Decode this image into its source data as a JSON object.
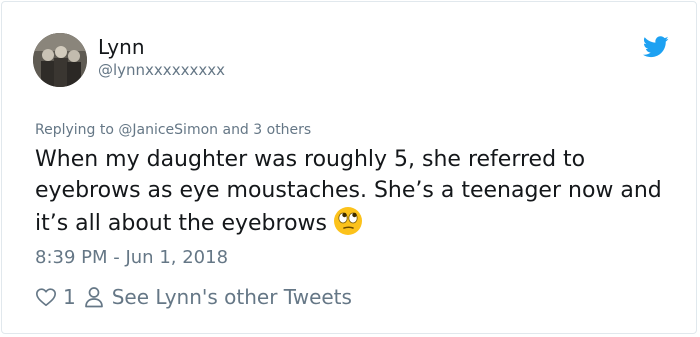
{
  "tweet": {
    "author_name": "Lynn",
    "author_handle": "@lynnxxxxxxxxx",
    "reply_prefix": "Replying to",
    "reply_mention": "@JaniceSimon",
    "reply_suffix": "and 3 others",
    "text": "When my daughter was roughly 5, she referred to eyebrows as eye moustaches. She’s a teenager now and it’s all about the eyebrows",
    "emoji": "face-with-rolling-eyes",
    "timestamp": "8:39 PM - Jun 1, 2018",
    "like_count": "1",
    "other_tweets_link": "See Lynn's other Tweets",
    "brand_color": "#1da1f2"
  }
}
